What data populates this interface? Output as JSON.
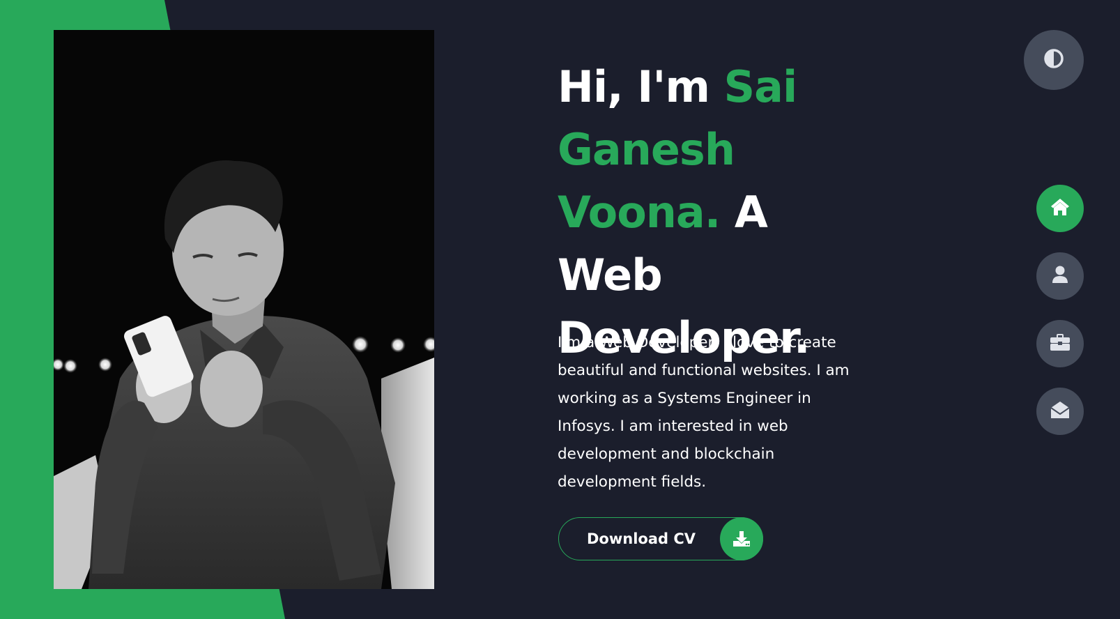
{
  "hero": {
    "greeting": "Hi, I'm ",
    "name": "Sai Ganesh Voona.",
    "role": " A Web Developer.",
    "description": "I'm a Web Developer, I love to create beautiful and functional websites. I am working as a Systems Engineer in Infosys. I am interested in web development and blockchain development fields."
  },
  "cv_button": {
    "label": "Download CV",
    "icon": "download-icon"
  },
  "nav": {
    "items": [
      {
        "icon": "home-icon",
        "active": true
      },
      {
        "icon": "user-icon",
        "active": false
      },
      {
        "icon": "briefcase-icon",
        "active": false
      },
      {
        "icon": "envelope-open-icon",
        "active": false
      }
    ]
  },
  "theme_toggle": {
    "icon": "adjust-icon"
  },
  "colors": {
    "background": "#1b1e2c",
    "accent": "#28a95a",
    "button_gray": "#454c5b",
    "text": "#ffffff"
  }
}
